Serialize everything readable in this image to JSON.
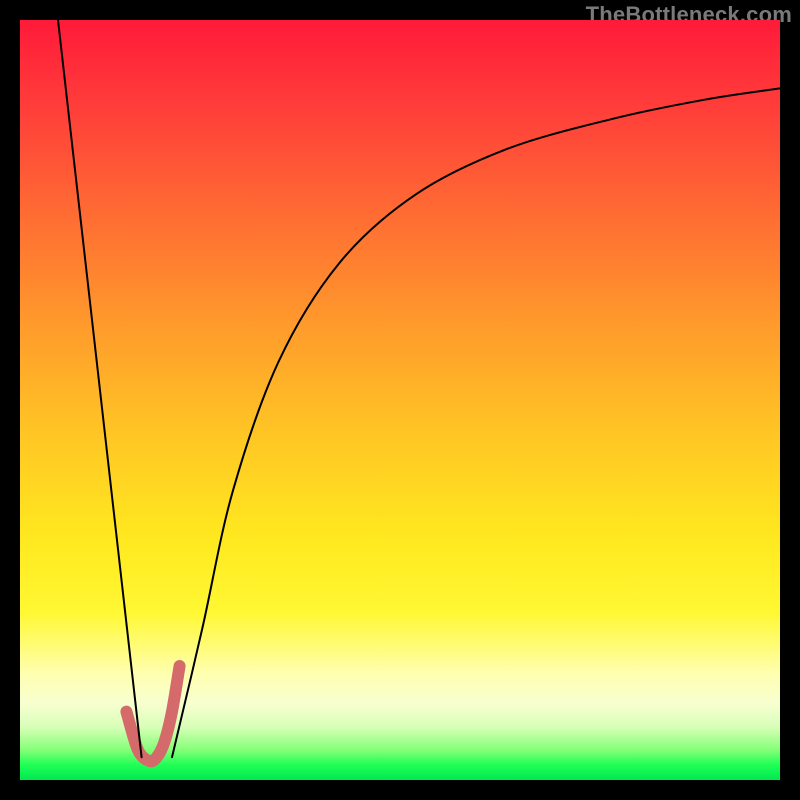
{
  "watermark": "TheBottleneck.com",
  "chart_data": {
    "type": "line",
    "title": "",
    "xlabel": "",
    "ylabel": "",
    "xlim": [
      0,
      100
    ],
    "ylim": [
      0,
      100
    ],
    "grid": false,
    "legend": false,
    "series": [
      {
        "name": "left-line",
        "color": "#000000",
        "stroke_width": 2,
        "x": [
          5,
          16
        ],
        "y": [
          100,
          3
        ]
      },
      {
        "name": "right-curve",
        "color": "#000000",
        "stroke_width": 2,
        "x": [
          20,
          24,
          28,
          34,
          42,
          52,
          64,
          78,
          90,
          100
        ],
        "y": [
          3,
          20,
          38,
          55,
          68,
          77,
          83,
          87,
          89.5,
          91
        ]
      },
      {
        "name": "valley-highlight",
        "color": "#d46a6a",
        "stroke_width": 12,
        "x": [
          14,
          15.5,
          17,
          18,
          19,
          20,
          21
        ],
        "y": [
          9,
          4,
          2.5,
          3,
          5,
          9,
          15
        ]
      }
    ],
    "background_gradient": {
      "top": "#ff1a3a",
      "mid": "#ffe81f",
      "bottom": "#00e851"
    }
  }
}
